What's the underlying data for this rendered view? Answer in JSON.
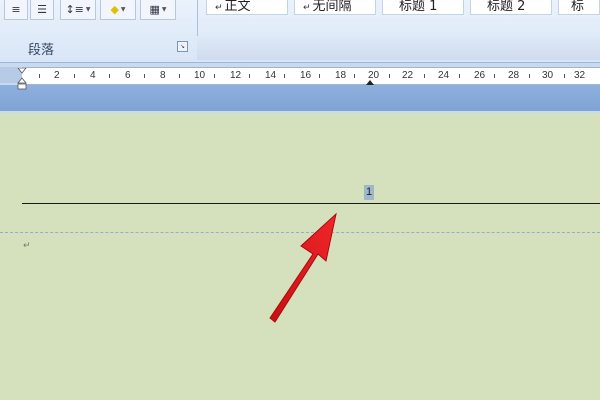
{
  "ribbon": {
    "paragraph_group_label": "段落",
    "tools": [
      {
        "name": "align-justify-icon",
        "glyph": "≡"
      },
      {
        "name": "distributed-icon",
        "glyph": "☰"
      },
      {
        "name": "line-spacing-icon",
        "glyph": "↕≡"
      },
      {
        "name": "shading-icon",
        "glyph": "◆"
      },
      {
        "name": "borders-icon",
        "glyph": "▦"
      }
    ],
    "styles": [
      {
        "mark": "↵",
        "label": "正文"
      },
      {
        "mark": "↵",
        "label": "无间隔"
      },
      {
        "mark": "",
        "label": "标题 1"
      },
      {
        "mark": "",
        "label": "标题 2"
      },
      {
        "mark": "",
        "label": "标"
      }
    ],
    "launcher_glyph": "↘"
  },
  "ruler": {
    "marks": [
      "2",
      "4",
      "6",
      "8",
      "10",
      "12",
      "14",
      "16",
      "18",
      "20",
      "22",
      "24",
      "26",
      "28",
      "30",
      "32"
    ]
  },
  "document": {
    "header_page_number": "1",
    "paragraph_mark": "↵"
  },
  "annotation": {
    "arrow_color": "#e8191d"
  }
}
